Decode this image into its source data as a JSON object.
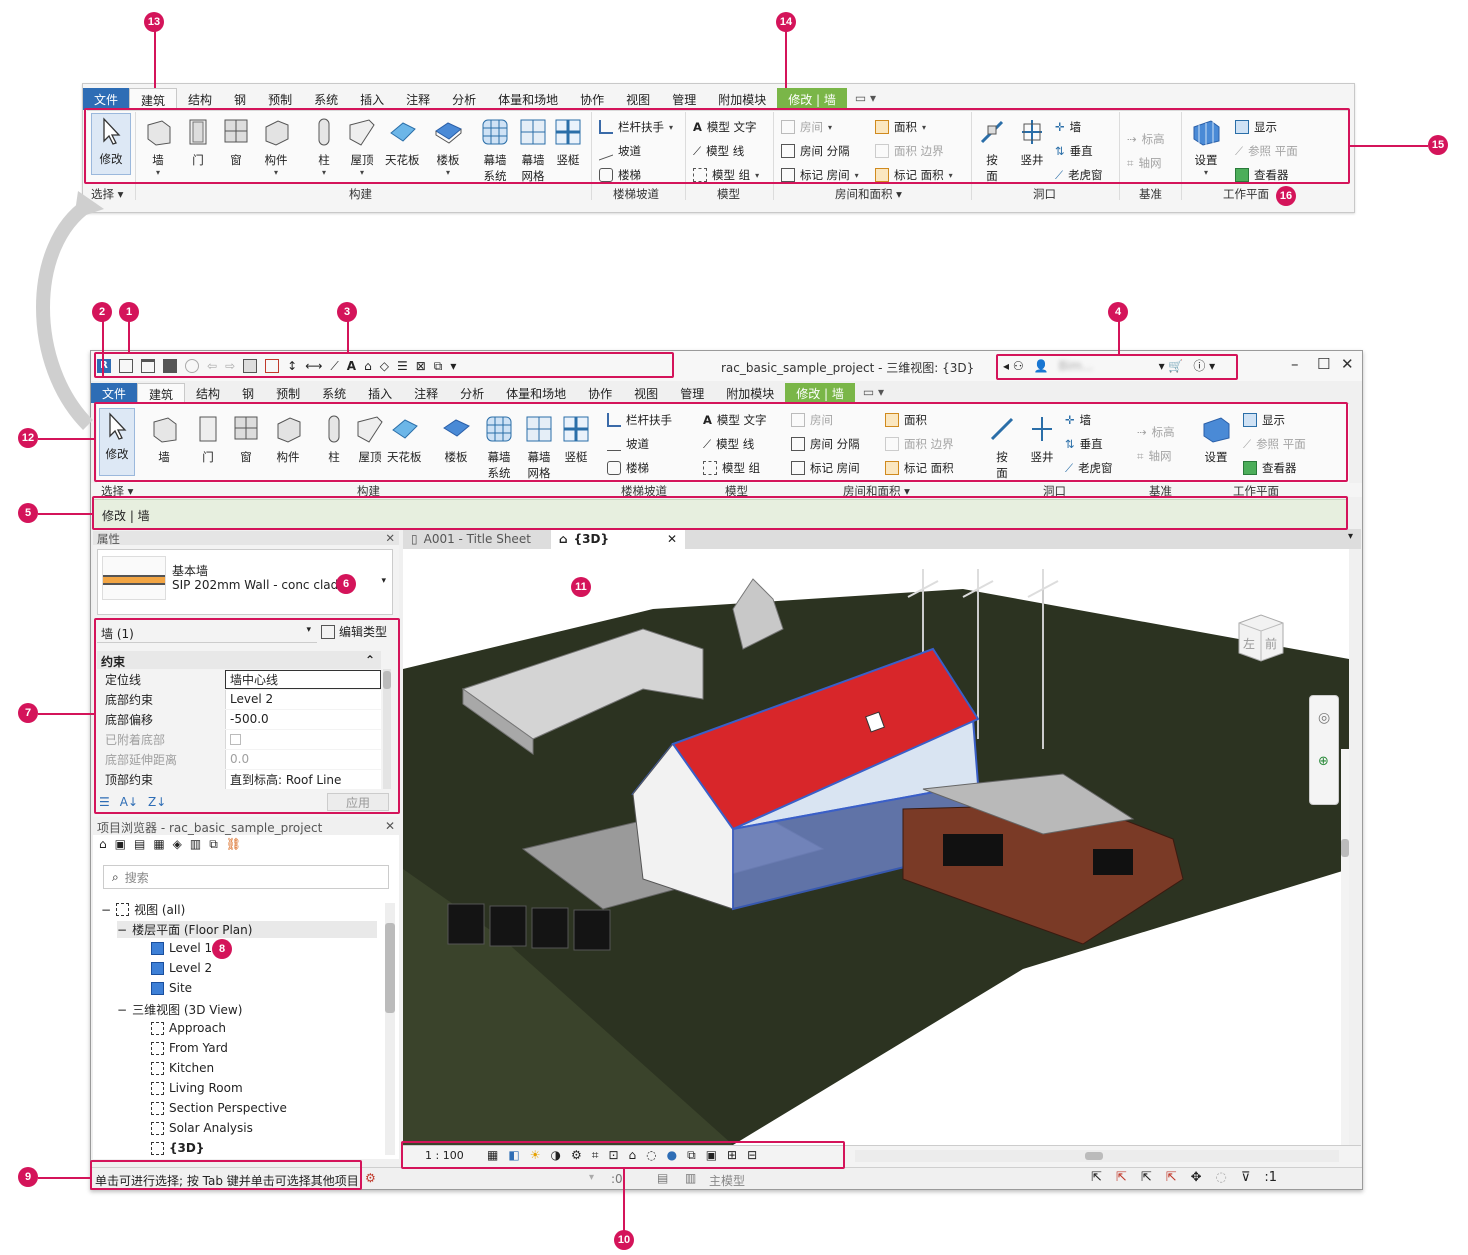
{
  "tabs": [
    "文件",
    "建筑",
    "结构",
    "钢",
    "预制",
    "系统",
    "插入",
    "注释",
    "分析",
    "体量和场地",
    "协作",
    "视图",
    "管理",
    "附加模块",
    "修改 | 墙"
  ],
  "ribbon": {
    "select": "修改",
    "build": [
      "墙",
      "门",
      "窗",
      "构件",
      "柱",
      "屋顶",
      "天花板",
      "楼板",
      "幕墙\n系统",
      "幕墙\n网格",
      "竖梃"
    ],
    "stairs": [
      "栏杆扶手",
      "坡道",
      "楼梯"
    ],
    "model": [
      "模型 文字",
      "模型 线",
      "模型 组"
    ],
    "room": [
      "房间",
      "房间 分隔",
      "标记 房间"
    ],
    "area": [
      "面积",
      "面积 边界",
      "标记 面积"
    ],
    "opening_big": [
      "按\n面",
      "竖井"
    ],
    "opening_small": [
      "墙",
      "垂直",
      "老虎窗"
    ],
    "datum": [
      "标高",
      "轴网"
    ],
    "workplane": [
      "设置",
      "显示",
      "参照 平面",
      "查看器"
    ]
  },
  "groups": {
    "select": "选择",
    "build": "构建",
    "stairs": "楼梯坡道",
    "model": "模型",
    "room": "房间和面积",
    "opening": "洞口",
    "datum": "基准",
    "workplane": "工作平面"
  },
  "window": {
    "title": "rac_basic_sample_project - 三维视图: {3D}",
    "context_bar": "修改 | 墙",
    "account": "Bim..."
  },
  "properties": {
    "header": "属性",
    "type_family": "基本墙",
    "type_name": "SIP 202mm Wall - conc clad",
    "instance_filter": "墙 (1)",
    "edit_type": "编辑类型",
    "section": "约束",
    "rows": [
      {
        "key": "定位线",
        "value": "墙中心线"
      },
      {
        "key": "底部约束",
        "value": "Level 2"
      },
      {
        "key": "底部偏移",
        "value": "-500.0"
      },
      {
        "key": "已附着底部",
        "value": ""
      },
      {
        "key": "底部延伸距离",
        "value": "0.0"
      },
      {
        "key": "顶部约束",
        "value": "直到标高: Roof Line"
      }
    ],
    "apply": "应用"
  },
  "browser": {
    "header": "项目浏览器 - rac_basic_sample_project",
    "search_placeholder": "搜索",
    "root": "视图 (all)",
    "floor_plans": "楼层平面 (Floor Plan)",
    "floor_items": [
      "Level 1",
      "Level 2",
      "Site"
    ],
    "views_3d": "三维视图 (3D View)",
    "views_3d_items": [
      "Approach",
      "From Yard",
      "Kitchen",
      "Living Room",
      "Section Perspective",
      "Solar Analysis",
      "{3D}"
    ]
  },
  "view_tabs": [
    "A001 - Title Sheet",
    "{3D}"
  ],
  "viewcube": {
    "left": "左",
    "front": "前"
  },
  "view_bar": {
    "scale": "1 : 100"
  },
  "status": {
    "message": "单击可进行选择; 按 Tab 键并单击可选择其他项目",
    "zero": ":0",
    "model": "主模型",
    "filter": ":1"
  },
  "callouts": [
    "1",
    "2",
    "3",
    "4",
    "5",
    "6",
    "7",
    "8",
    "9",
    "10",
    "11",
    "12",
    "13",
    "14",
    "15",
    "16"
  ],
  "colors": {
    "accent": "#d4145a",
    "file_tab": "#2e6db5",
    "modify_tab": "#7ab648",
    "roof": "#d8262a",
    "terrain": "#2c3321",
    "cladding": "#7a3a26"
  }
}
